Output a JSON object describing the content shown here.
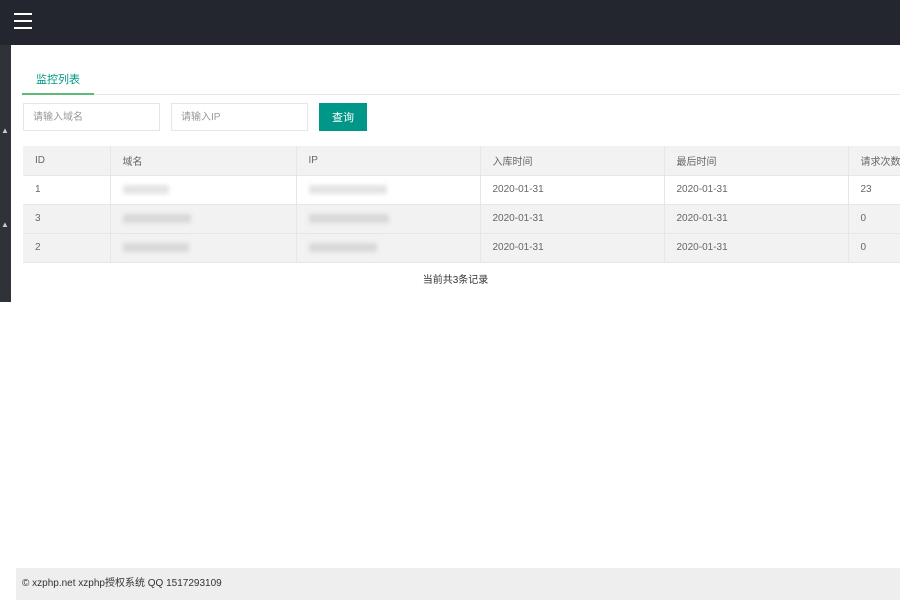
{
  "header": {
    "menu_icon": "hamburger-menu-icon"
  },
  "sidebar": {
    "items": [
      {
        "icon": "chevron-icon"
      },
      {
        "icon": "chevron-icon"
      }
    ]
  },
  "tab": {
    "label": "监控列表"
  },
  "search": {
    "domain_placeholder": "请输入域名",
    "ip_placeholder": "请输入IP",
    "button_label": "查询"
  },
  "table": {
    "headers": [
      "ID",
      "域名",
      "IP",
      "入库时间",
      "最后时间",
      "请求次数"
    ],
    "rows": [
      {
        "id": "1",
        "domain": "██████████",
        "ip": "████████████",
        "created": "2020-01-31",
        "last": "2020-01-31",
        "count": "23"
      },
      {
        "id": "3",
        "domain": "██████████",
        "ip": "████████████",
        "created": "2020-01-31",
        "last": "2020-01-31",
        "count": "0"
      },
      {
        "id": "2",
        "domain": "██████████",
        "ip": "████████████",
        "created": "2020-01-31",
        "last": "2020-01-31",
        "count": "0"
      }
    ]
  },
  "summary": {
    "total_text": "当前共3条记录"
  },
  "footer": {
    "text": "© xzphp.net xzphp授权系统 QQ 1517293109"
  },
  "colors": {
    "accent": "#009688",
    "tab_underline": "#5fb878",
    "topbar": "#23262e"
  }
}
